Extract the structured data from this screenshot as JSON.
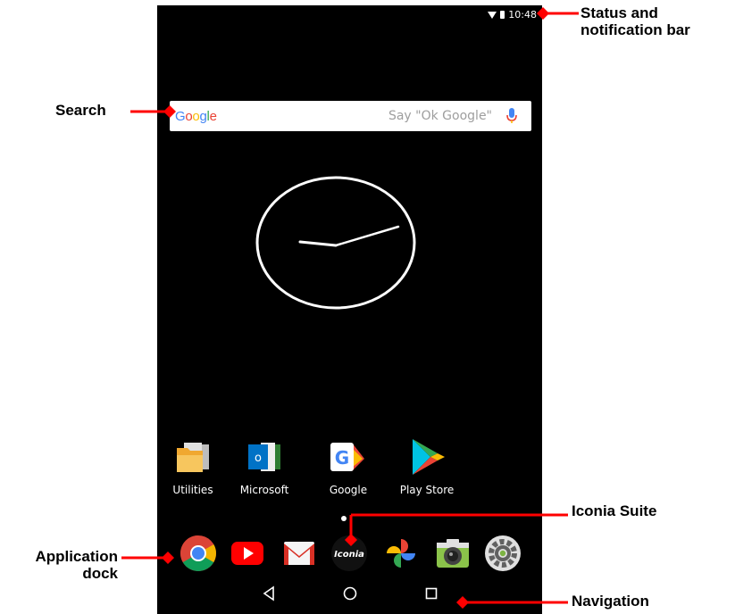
{
  "status_bar": {
    "time": "10:48"
  },
  "search": {
    "logo": "Google",
    "hint": "Say \"Ok Google\""
  },
  "apps": [
    {
      "label": "Utilities",
      "icon": "utilities-folder-icon"
    },
    {
      "label": "Microsoft",
      "icon": "microsoft-folder-icon"
    },
    {
      "label": "Google",
      "icon": "google-folder-icon"
    },
    {
      "label": "Play Store",
      "icon": "play-store-icon"
    }
  ],
  "dock": {
    "items": [
      "chrome-icon",
      "youtube-icon",
      "gmail-icon",
      "iconia-suite-icon",
      "photos-icon",
      "camera-icon",
      "settings-icon"
    ],
    "iconia_label": "Iconia"
  },
  "navigation": {
    "buttons": [
      "back-icon",
      "home-icon",
      "recents-icon"
    ]
  },
  "callouts": {
    "status": "Status and notification bar",
    "search": "Search",
    "iconia": "Iconia Suite",
    "dock": "Application dock",
    "navigation": "Navigation"
  },
  "colors": {
    "callout_marker": "#ff0000",
    "google_blue": "#4285f4",
    "google_red": "#ea4335",
    "google_yellow": "#fbbc05",
    "google_green": "#34a853"
  }
}
